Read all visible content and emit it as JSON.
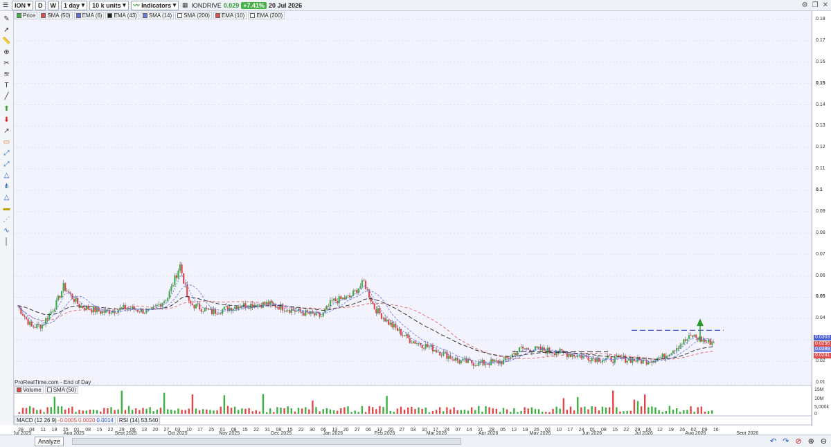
{
  "toolbar": {
    "ticker": "ION",
    "d_label": "D",
    "w_label": "W",
    "interval": "1 day",
    "units": "10 k units",
    "indicators_label": "Indicators",
    "quote_name": "IONDRIVE",
    "quote_price": "0.029",
    "quote_change": "+7.41%",
    "quote_date": "20 Jul 2026"
  },
  "legend": {
    "price": "Price",
    "items": [
      {
        "label": "SMA (50)",
        "color": "#e05050"
      },
      {
        "label": "EMA (6)",
        "color": "#5a6ee0"
      },
      {
        "label": "EMA (43)",
        "color": "#222222"
      },
      {
        "label": "SMA (14)",
        "color": "#6a7ae0"
      },
      {
        "label": "SMA (200)",
        "color": "#ffffff"
      },
      {
        "label": "EMA (10)",
        "color": "#e05050"
      },
      {
        "label": "EMA (200)",
        "color": "#ffffff"
      }
    ]
  },
  "source_note": "ProRealTime.com - End of Day",
  "volume_legend": {
    "volume": "Volume",
    "sma": "SMA (50)"
  },
  "indicator_legend": {
    "macd_label": "MACD (12 26 9)",
    "macd_v1": "-0.0005",
    "macd_v2": "0.0020",
    "macd_v3": "0.0014",
    "rsi_label": "RSI (14)",
    "rsi_value": "53.540"
  },
  "price_axis": [
    "0.18",
    "0.17",
    "0.16",
    "0.15",
    "0.14",
    "0.13",
    "0.12",
    "0.11",
    "0.1",
    "0.09",
    "0.08",
    "0.07",
    "0.06",
    "0.05",
    "0.04",
    "0.03",
    "0.02",
    "0.01"
  ],
  "price_tags": [
    {
      "text": "0.0303",
      "color": "#4a5fd0"
    },
    {
      "text": "0.0296",
      "color": "#e05050"
    },
    {
      "text": "0.0289",
      "color": "#7080e0"
    },
    {
      "text": "0.0241",
      "color": "#e05050"
    }
  ],
  "volume_axis": [
    "15M",
    "10M",
    "5,000k",
    "0"
  ],
  "date_axis_days": [
    "28",
    "04",
    "11",
    "18",
    "25",
    "01",
    "08",
    "15",
    "22",
    "29",
    "06",
    "13",
    "20",
    "27",
    "03",
    "10",
    "17",
    "25",
    "01",
    "08",
    "15",
    "22",
    "31",
    "08",
    "15",
    "22",
    "30",
    "06",
    "13",
    "20",
    "27",
    "06",
    "13",
    "20",
    "27",
    "03",
    "10",
    "17",
    "24",
    "07",
    "14",
    "21",
    "28",
    "05",
    "12",
    "19",
    "26",
    "02",
    "10",
    "17",
    "24",
    "01",
    "08",
    "15",
    "22",
    "29",
    "05",
    "12",
    "19",
    "26",
    "02",
    "09",
    "16"
  ],
  "date_axis_months": [
    "Jul 2025",
    "Aug 2025",
    "Sept 2025",
    "Oct 2025",
    "Nov 2025",
    "Dec 2025",
    "Jan 2026",
    "Feb 2026",
    "Mar 2026",
    "Apr 2026",
    "May 2026",
    "Jun 2026",
    "Jul 2026",
    "Aug 2026",
    "Sept 2026"
  ],
  "bottom": {
    "analyze": "Analyze"
  },
  "colors": {
    "up": "#3cb043",
    "down": "#e04848",
    "bg": "#eef0fb"
  }
}
